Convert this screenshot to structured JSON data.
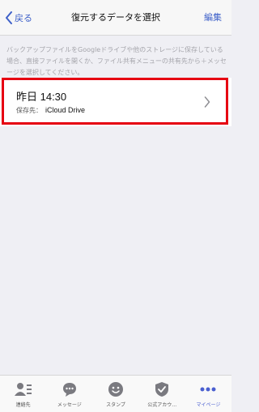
{
  "nav": {
    "back_label": "戻る",
    "title": "復元するデータを選択",
    "edit_label": "編集"
  },
  "description": "バックアップファイルをGoogleドライブや他のストレージに保存している場合、直接ファイルを開くか、ファイル共有メニューの共有先から＋メッセージを選択してください。",
  "backup": {
    "time": "昨日 14:30",
    "destination_label": "保存先：",
    "destination_value": "iCloud Drive"
  },
  "tabs": [
    {
      "label": "連絡先",
      "icon": "contacts-icon"
    },
    {
      "label": "メッセージ",
      "icon": "message-icon"
    },
    {
      "label": "スタンプ",
      "icon": "sticker-icon"
    },
    {
      "label": "公式アカウ…",
      "icon": "official-account-icon"
    },
    {
      "label": "マイページ",
      "icon": "more-icon",
      "active": true
    }
  ],
  "colors": {
    "accent": "#3f61c9",
    "highlight": "#e60012",
    "active_tab": "#4a5fd0"
  }
}
